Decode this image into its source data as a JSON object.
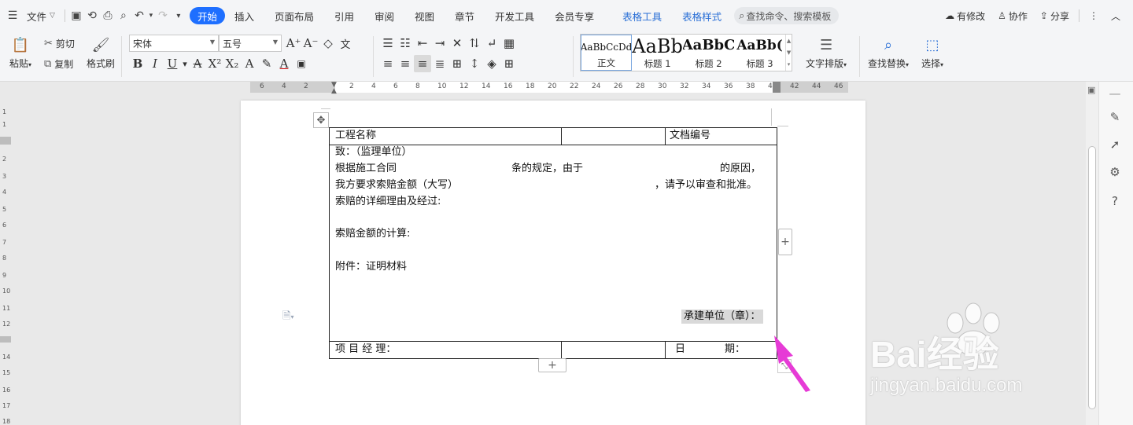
{
  "menubar": {
    "file_label": "文件",
    "tabs": [
      "开始",
      "插入",
      "页面布局",
      "引用",
      "审阅",
      "视图",
      "章节",
      "开发工具",
      "会员专享"
    ],
    "context_tabs": [
      "表格工具",
      "表格样式"
    ],
    "search_placeholder": "查找命令、搜索模板",
    "right": {
      "modified": "有修改",
      "collab": "协作",
      "share": "分享"
    }
  },
  "ribbon": {
    "paste": "粘贴",
    "cut": "剪切",
    "copy": "复制",
    "format_painter": "格式刷",
    "font_name": "宋体",
    "font_size": "五号",
    "styles": [
      {
        "sample": "AaBbCcDd",
        "name": "正文"
      },
      {
        "sample": "AaBb",
        "name": "标题 1"
      },
      {
        "sample": "AaBbC",
        "name": "标题 2"
      },
      {
        "sample": "AaBb(",
        "name": "标题 3"
      }
    ],
    "text_layout": "文字排版",
    "find_replace": "查找替换",
    "select": "选择"
  },
  "ruler": {
    "ticks": [
      "6",
      "4",
      "2",
      "2",
      "4",
      "6",
      "8",
      "10",
      "12",
      "14",
      "16",
      "18",
      "20",
      "22",
      "24",
      "26",
      "28",
      "30",
      "32",
      "34",
      "36",
      "38",
      "40",
      "42",
      "44",
      "46"
    ]
  },
  "vruler": {
    "ticks": [
      "1",
      "1",
      "2",
      "3",
      "4",
      "5",
      "6",
      "7",
      "8",
      "9",
      "10",
      "11",
      "12",
      "14",
      "15",
      "16",
      "17",
      "18"
    ]
  },
  "document": {
    "header": {
      "project_name": "工程名称",
      "doc_number": "文档编号"
    },
    "body": {
      "to": "致：（监理单位）",
      "line1_a": "根据施工合同",
      "line1_b": "条的规定，由于",
      "line1_c": "的原因，",
      "line2_a": "我方要求索赔金额（大写）",
      "line2_b": "，请予以审查和批准。",
      "reason": "索赔的详细理由及经过:",
      "calc": "索赔金额的计算:",
      "attachment": "附件：证明材料",
      "contractor": "承建单位（章）："
    },
    "footer": {
      "manager": "项 目 经 理：",
      "date_a": "日",
      "date_b": "期："
    }
  },
  "watermark": {
    "brand": "Bai经验",
    "url": "jingyan.baidu.com"
  },
  "colors": {
    "accent": "#1e6fff",
    "context_tab": "#2a6fd6",
    "arrow": "#e63bd6"
  }
}
